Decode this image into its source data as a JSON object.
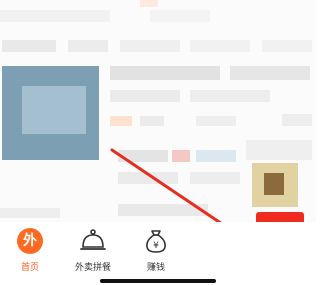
{
  "tabbar": {
    "items": [
      {
        "label": "首页",
        "icon": "home-wai-icon",
        "glyph": "外",
        "active": true
      },
      {
        "label": "外卖拼餐",
        "icon": "cloche-icon",
        "active": false
      },
      {
        "label": "赚钱",
        "icon": "money-bag-icon",
        "glyph": "¥",
        "active": false
      }
    ]
  },
  "colors": {
    "accent": "#ff6a23",
    "arrow": "#e52e1c",
    "thumbnail": "#7d9fb3",
    "red_tag": "#ee2b1e"
  }
}
